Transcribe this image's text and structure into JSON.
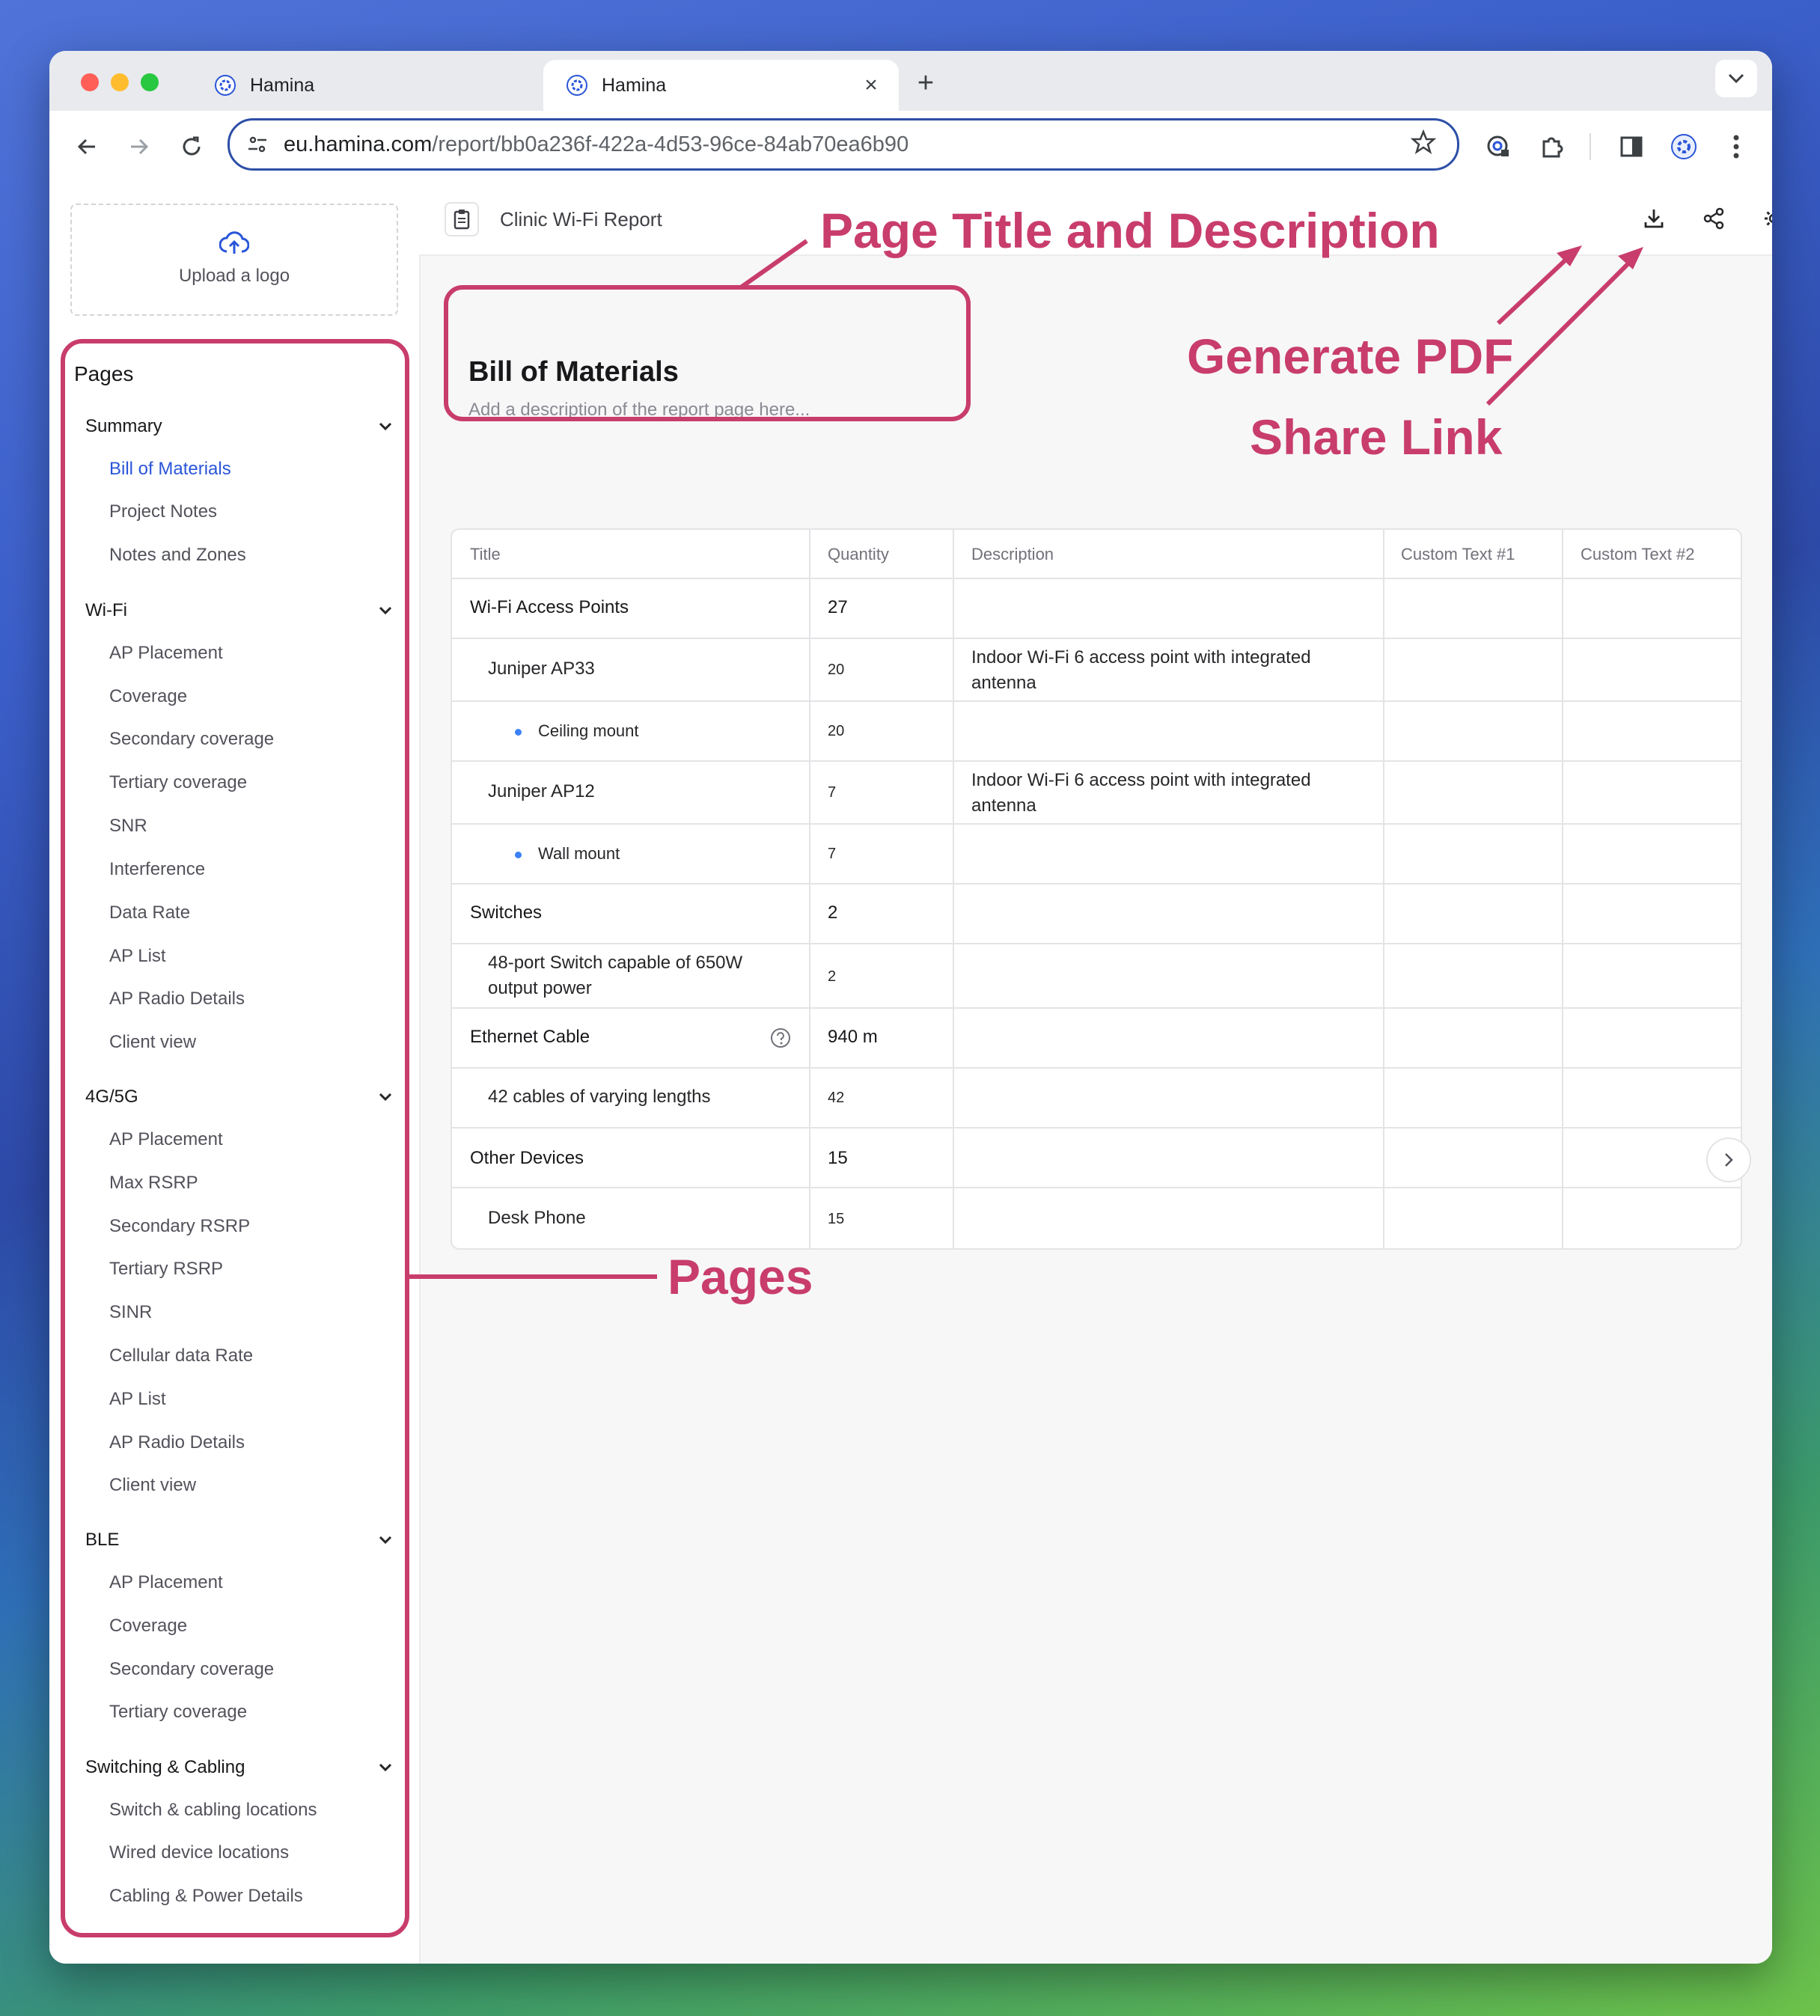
{
  "browser": {
    "tabs": [
      {
        "title": "Hamina"
      },
      {
        "title": "Hamina"
      }
    ],
    "url_host": "eu.hamina.com",
    "url_path": "/report/bb0a236f-422a-4d53-96ce-84ab70ea6b90"
  },
  "sidebar": {
    "upload_label": "Upload a logo",
    "pages_heading": "Pages",
    "groups": [
      {
        "label": "Summary",
        "items": [
          "Bill of Materials",
          "Project Notes",
          "Notes and Zones"
        ]
      },
      {
        "label": "Wi-Fi",
        "items": [
          "AP Placement",
          "Coverage",
          "Secondary coverage",
          "Tertiary coverage",
          "SNR",
          "Interference",
          "Data Rate",
          "AP List",
          "AP Radio Details",
          "Client view"
        ]
      },
      {
        "label": "4G/5G",
        "items": [
          "AP Placement",
          "Max RSRP",
          "Secondary RSRP",
          "Tertiary RSRP",
          "SINR",
          "Cellular data Rate",
          "AP List",
          "AP Radio Details",
          "Client view"
        ]
      },
      {
        "label": "BLE",
        "items": [
          "AP Placement",
          "Coverage",
          "Secondary coverage",
          "Tertiary coverage"
        ]
      },
      {
        "label": "Switching & Cabling",
        "items": [
          "Switch & cabling locations",
          "Wired device locations",
          "Cabling & Power Details"
        ]
      }
    ],
    "active_item": "Bill of Materials"
  },
  "main": {
    "report_name": "Clinic Wi-Fi Report",
    "page_title": "Bill of Materials",
    "page_description_placeholder": "Add a description of the report page here...",
    "table": {
      "headers": [
        "Title",
        "Quantity",
        "Description",
        "Custom Text #1",
        "Custom Text #2"
      ],
      "rows": [
        {
          "title": "Wi-Fi Access Points",
          "quantity": "27",
          "description": "",
          "level": 0
        },
        {
          "title": "Juniper AP33",
          "quantity": "20",
          "description": "Indoor Wi-Fi 6 access point with integrated antenna",
          "level": 1
        },
        {
          "title": "Ceiling mount",
          "quantity": "20",
          "description": "",
          "level": 2
        },
        {
          "title": "Juniper AP12",
          "quantity": "7",
          "description": "Indoor Wi-Fi 6 access point with integrated antenna",
          "level": 1
        },
        {
          "title": "Wall mount",
          "quantity": "7",
          "description": "",
          "level": 2
        },
        {
          "title": "Switches",
          "quantity": "2",
          "description": "",
          "level": 0
        },
        {
          "title": "48-port Switch capable of 650W output power",
          "quantity": "2",
          "description": "",
          "level": 1
        },
        {
          "title": "Ethernet Cable",
          "quantity": "940 m",
          "description": "",
          "level": 0
        },
        {
          "title": "42 cables of varying lengths",
          "quantity": "42",
          "description": "",
          "level": 1
        },
        {
          "title": "Other Devices",
          "quantity": "15",
          "description": "",
          "level": 0
        },
        {
          "title": "Desk Phone",
          "quantity": "15",
          "description": "",
          "level": 1
        }
      ]
    }
  },
  "annotations": {
    "title_desc": "Page Title and Description",
    "generate_pdf": "Generate PDF",
    "share_link": "Share Link",
    "pages": "Pages",
    "color": "#c83d6b"
  }
}
